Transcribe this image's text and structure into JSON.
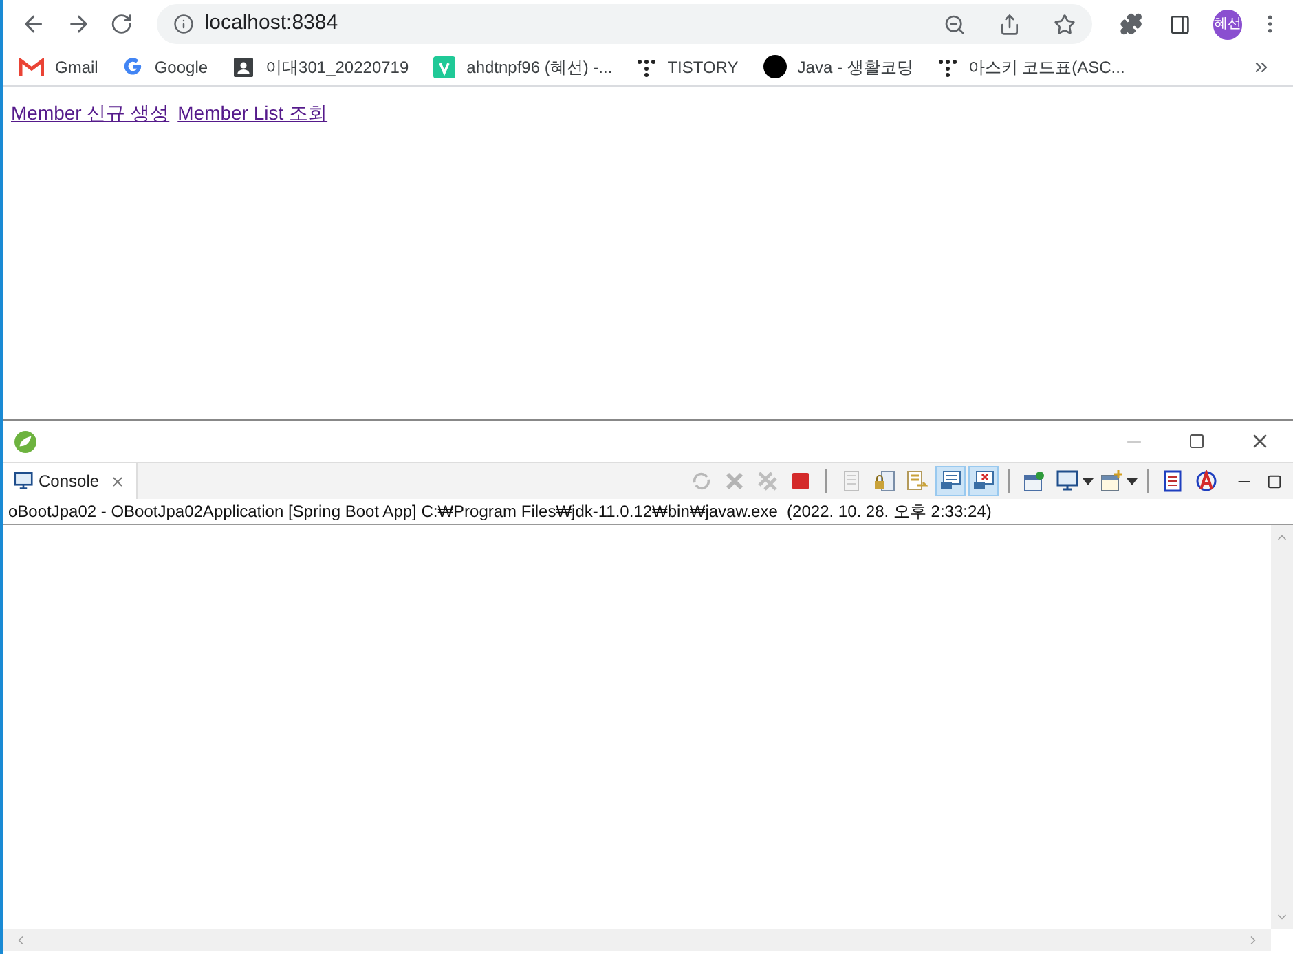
{
  "browser": {
    "url": "localhost:8384",
    "profile": "혜선",
    "bookmarks": [
      {
        "kind": "gmail",
        "label": "Gmail"
      },
      {
        "kind": "google",
        "label": "Google"
      },
      {
        "kind": "contact",
        "label": "이대301_20220719"
      },
      {
        "kind": "v",
        "label": "ahdtnpf96 (혜선) -..."
      },
      {
        "kind": "dots",
        "label": "TISTORY"
      },
      {
        "kind": "circle",
        "label": "Java - 생활코딩"
      },
      {
        "kind": "dots",
        "label": "아스키 코드표(ASC..."
      }
    ]
  },
  "page": {
    "links": [
      "Member 신규 생성",
      "Member List 조회"
    ]
  },
  "console": {
    "tab": {
      "label": "Console"
    },
    "toolbar": [
      {
        "kind": "sync",
        "disabled": true,
        "pressed": false
      },
      {
        "kind": "remove",
        "disabled": true,
        "pressed": false
      },
      {
        "kind": "remove-all",
        "disabled": true,
        "pressed": false
      },
      {
        "kind": "terminate",
        "disabled": false,
        "pressed": false
      },
      {
        "kind": "sep"
      },
      {
        "kind": "clear",
        "disabled": true,
        "pressed": false
      },
      {
        "kind": "scroll-lock",
        "disabled": false,
        "pressed": false
      },
      {
        "kind": "word-wrap",
        "disabled": false,
        "pressed": false
      },
      {
        "kind": "show-out",
        "disabled": false,
        "pressed": true
      },
      {
        "kind": "show-err",
        "disabled": false,
        "pressed": true
      },
      {
        "kind": "sep"
      },
      {
        "kind": "pin",
        "disabled": false,
        "pressed": false
      },
      {
        "kind": "display",
        "disabled": false,
        "pressed": false,
        "dropdown": true
      },
      {
        "kind": "new-console",
        "disabled": false,
        "pressed": false,
        "dropdown": true
      },
      {
        "kind": "sep"
      },
      {
        "kind": "doc",
        "disabled": false,
        "pressed": false
      },
      {
        "kind": "a",
        "disabled": false,
        "pressed": false
      }
    ],
    "header": "oBootJpa02 - OBootJpa02Application [Spring Boot App] C:₩Program Files₩jdk-11.0.12₩bin₩javaw.exe  (2022. 10. 28. 오후 2:33:24)"
  }
}
